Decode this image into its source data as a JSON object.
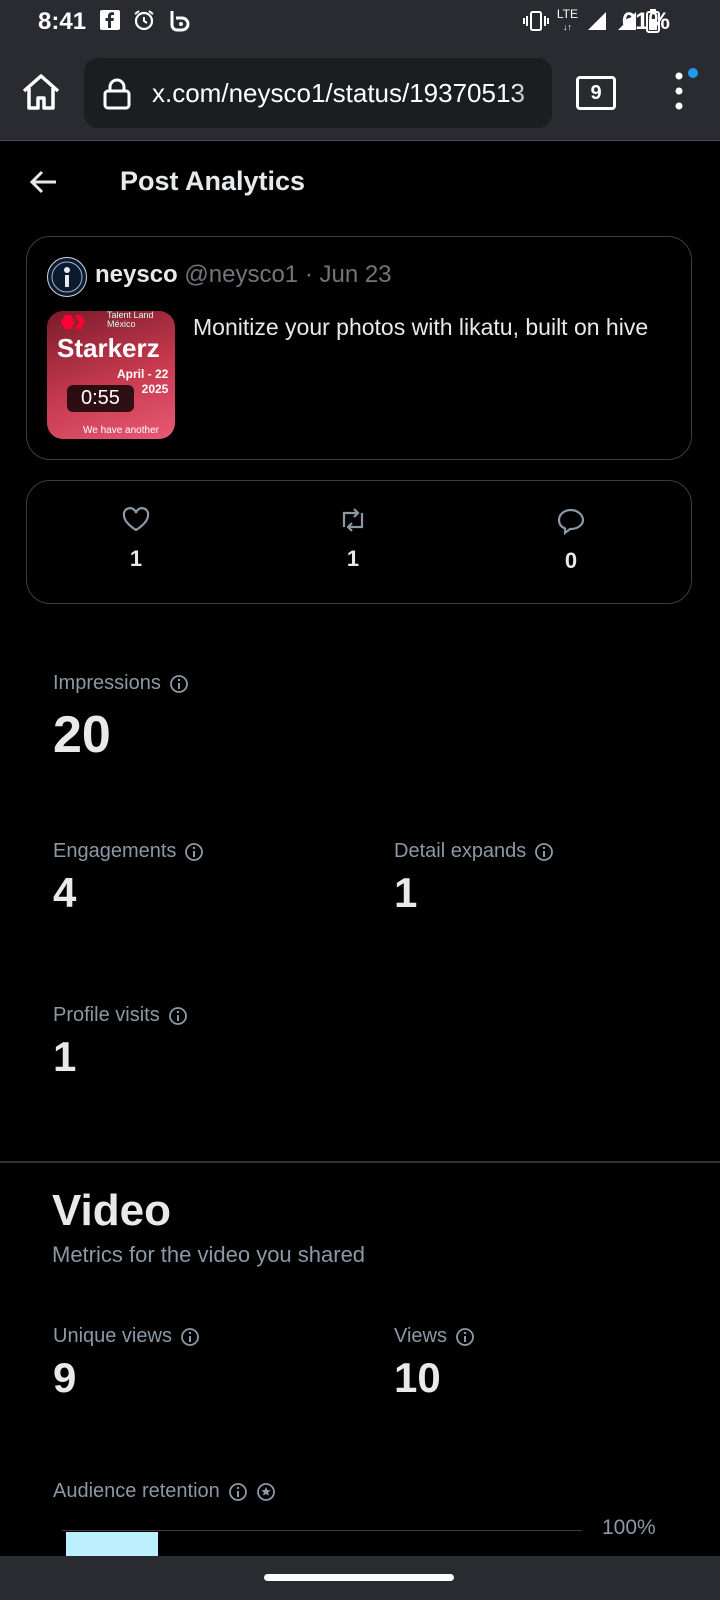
{
  "status_bar": {
    "time": "8:41",
    "network": "LTE",
    "battery": "61%"
  },
  "browser": {
    "url": "x.com/neysco1/status/19370513",
    "tab_count": "9",
    "accent": "#1d9bf0"
  },
  "header": {
    "title": "Post Analytics"
  },
  "post": {
    "display_name": "neysco",
    "handle_date": "@neysco1 · Jun 23",
    "text": "Monitize your photos with likatu, built on hive",
    "thumbnail": {
      "title": "Starkerz",
      "date_line1": "April - 22",
      "date_line2": "2025",
      "caption": "We have another",
      "logo_text": "Talent Land México",
      "duration": "0:55"
    }
  },
  "engagement": {
    "likes": "1",
    "reposts": "1",
    "replies": "0"
  },
  "metrics": {
    "impressions_label": "Impressions",
    "impressions": "20",
    "engagements_label": "Engagements",
    "engagements": "4",
    "detail_expands_label": "Detail expands",
    "detail_expands": "1",
    "profile_visits_label": "Profile visits",
    "profile_visits": "1"
  },
  "video": {
    "title": "Video",
    "subtitle": "Metrics for the video you shared",
    "unique_views_label": "Unique views",
    "unique_views": "9",
    "views_label": "Views",
    "views": "10",
    "retention_label": "Audience retention",
    "retention_axis_label": "100%",
    "retention_bar_color": "#bdf0ff"
  }
}
